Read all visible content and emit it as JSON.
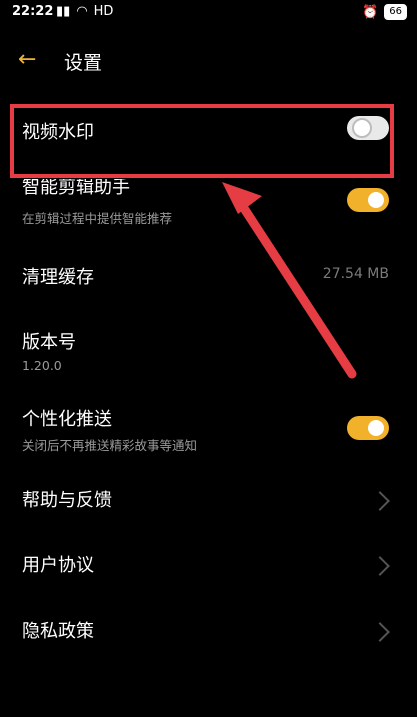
{
  "status": {
    "time": "22:22",
    "network": "HD",
    "battery": "66"
  },
  "header": {
    "title": "设置"
  },
  "settings": [
    {
      "title": "视频水印",
      "toggle": "off"
    },
    {
      "title": "智能剪辑助手",
      "subtitle": "在剪辑过程中提供智能推荐",
      "toggle": "on"
    },
    {
      "title": "清理缓存",
      "value": "27.54 MB"
    },
    {
      "title": "版本号",
      "subtitle": "1.20.0"
    },
    {
      "title": "个性化推送",
      "subtitle": "关闭后不再推送精彩故事等通知",
      "toggle": "on"
    },
    {
      "title": "帮助与反馈",
      "nav": true
    },
    {
      "title": "用户协议",
      "nav": true
    },
    {
      "title": "隐私政策",
      "nav": true
    }
  ],
  "colors": {
    "accent": "#f1b12a",
    "annotation": "#e63c43"
  }
}
